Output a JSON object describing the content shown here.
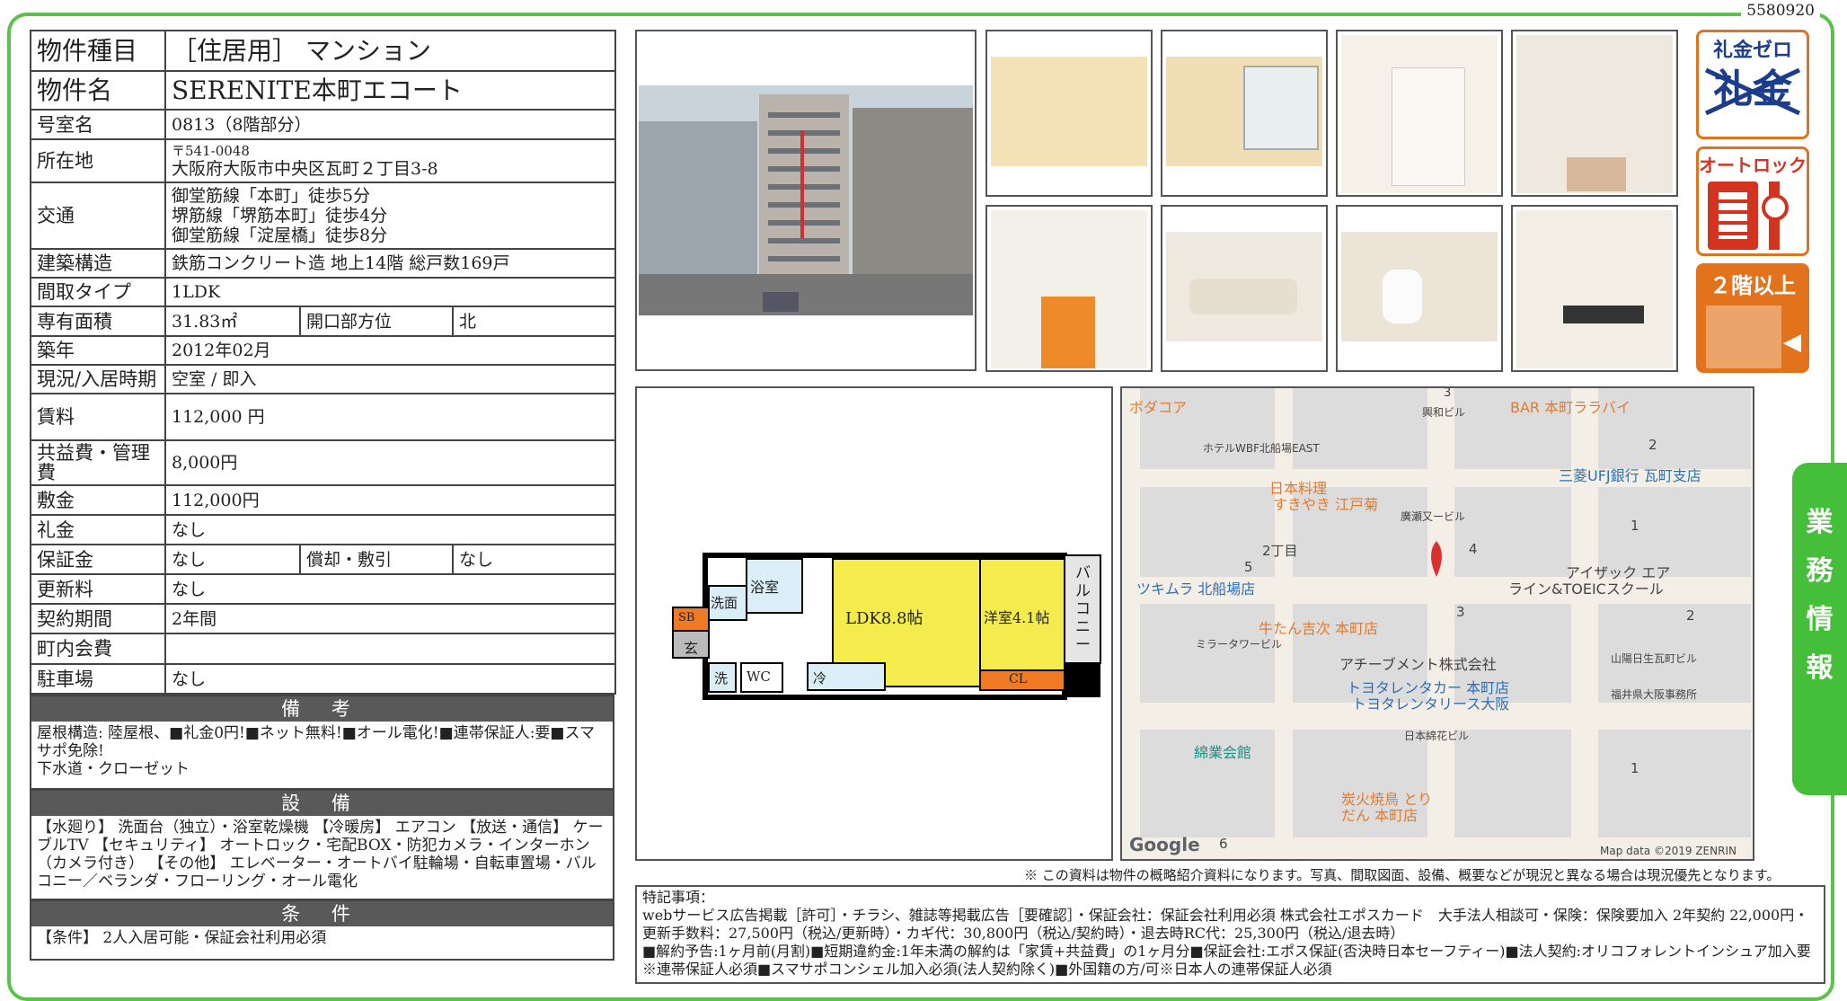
{
  "doc_id": "5580920",
  "property": {
    "type_label": "物件種目",
    "type_value": "［住居用］ マンション",
    "name_label": "物件名",
    "name_value": "SERENITE本町エコート",
    "room_label": "号室名",
    "room_value": "0813（8階部分）",
    "address_label": "所在地",
    "postal": "〒541-0048",
    "address": "大阪府大阪市中央区瓦町２丁目3-8",
    "traffic_label": "交通",
    "traffic": [
      "御堂筋線「本町」徒歩5分",
      "堺筋線「堺筋本町」徒歩4分",
      "御堂筋線「淀屋橋」徒歩8分"
    ],
    "structure_label": "建築構造",
    "structure_value": "鉄筋コンクリート造 地上14階 総戸数169戸",
    "layout_label": "間取タイプ",
    "layout_value": "1LDK",
    "area_label": "専有面積",
    "area_value": "31.83㎡",
    "direction_label": "開口部方位",
    "direction_value": "北",
    "built_label": "築年",
    "built_value": "2012年02月",
    "status_label": "現況/入居時期",
    "status_value": "空室 / 即入",
    "rent_label": "賃料",
    "rent_value": "112,000 円",
    "common_label": "共益費・管理費",
    "common_value": "8,000円",
    "deposit_label": "敷金",
    "deposit_value": "112,000円",
    "keymoney_label": "礼金",
    "keymoney_value": "なし",
    "guarantee_label": "保証金",
    "guarantee_value": "なし",
    "amort_label": "償却・敷引",
    "amort_value": "なし",
    "renewal_label": "更新料",
    "renewal_value": "なし",
    "contract_label": "契約期間",
    "contract_value": "2年間",
    "town_label": "町内会費",
    "town_value": "",
    "parking_label": "駐車場",
    "parking_value": "なし"
  },
  "remarks": {
    "title": "備 考",
    "text1": "屋根構造: 陸屋根、■礼金0円!■ネット無料!■オール電化!■連帯保証人:要■スマサポ免除!",
    "text2": "下水道・クローゼット"
  },
  "equipment": {
    "title": "設 備",
    "text": "【水廻り】 洗面台（独立）・浴室乾燥機 【冷暖房】 エアコン 【放送・通信】 ケーブルTV 【セキュリティ】 オートロック・宅配BOX・防犯カメラ・インターホン（カメラ付き） 【その他】 エレベーター・オートバイ駐輪場・自転車置場・バルコニー／ベランダ・フローリング・オール電化"
  },
  "conditions": {
    "title": "条 件",
    "text": "【条件】 2人入居可能・保証会社利用必須"
  },
  "badges": {
    "reikin_top": "礼金ゼロ",
    "reikin_main": "礼金",
    "autolock": "オートロック",
    "floor2": "２階以上"
  },
  "floorplan": {
    "ldk": "LDK8.8帖",
    "western": "洋室4.1帖",
    "bath": "浴室",
    "wash": "洗面",
    "sb": "SB",
    "entrance": "玄",
    "laundry": "洗",
    "wc": "WC",
    "fridge": "冷",
    "cl": "CL",
    "balcony": "バルコニー"
  },
  "map": {
    "labels": [
      "ボダコア",
      "ホテルWBF北船場EAST",
      "興和ビル",
      "BAR 本町ララバイ",
      "三菱UFJ銀行 瓦町支店",
      "日本料理",
      "すきやき 江戸菊",
      "廣瀬又ービル",
      "2丁目",
      "ツキムラ 北船場店",
      "アイザック エア",
      "ライン&TOEICスクール",
      "牛たん吉次 本町店",
      "ミラータワービル",
      "アチーブメント株式会社",
      "トヨタレンタカー 本町店",
      "トヨタレンタリース大阪",
      "山陽日生瓦町ビル",
      "福井県大阪事務所",
      "綿業会館",
      "日本綿花ビル",
      "炭火焼鳥 とり",
      "だん 本町店"
    ],
    "numbers": [
      "3",
      "2",
      "1",
      "5",
      "4",
      "3",
      "2",
      "1",
      "6"
    ],
    "google": "Google",
    "credit": "Map data ©2019 ZENRIN"
  },
  "notice": "※ この資料は物件の概略紹介資料になります。写真、間取図面、設備、概要などが現況と異なる場合は現況優先となります。",
  "special": {
    "title": "特記事項：",
    "line1": "webサービス広告掲載［許可］・チラシ、雑誌等掲載広告［要確認］・保証会社：保証会社利用必須 株式会社エポスカード　大手法人相談可・保険：保険要加入 2年契約 22,000円・更新手数料：27,500円（税込/更新時）・カギ代：30,800円（税込/契約時）・退去時RC代：25,300円（税込/退去時）",
    "line2": "■解約予告:1ヶ月前(月割)■短期違約金:1年未満の解約は「家賃+共益費」の1ヶ月分■保証会社:エポス保証(否決時日本セーフティー)■法人契約:オリコフォレントインシュア加入要※連帯保証人必須■スマサポコンシェル加入必須(法人契約除く)■外国籍の方/可※日本人の連帯保証人必須"
  },
  "side_tab": [
    "業",
    "務",
    "情",
    "報"
  ],
  "colors": {
    "frame": "#5ac24a",
    "badge": "#e2731c",
    "section_bar": "#595959",
    "floorplan_ldk": "#f4ec4c",
    "floorplan_cl": "#f07a23"
  }
}
